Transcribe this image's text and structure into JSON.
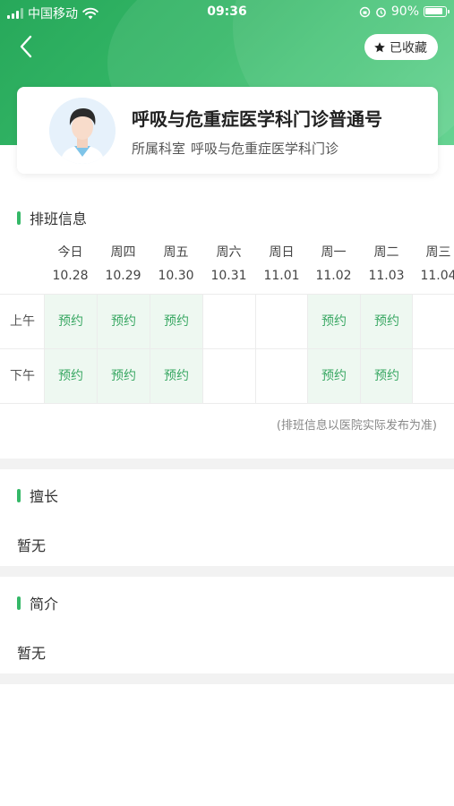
{
  "status_bar": {
    "carrier": "中国移动",
    "time": "09:36",
    "battery": "90%"
  },
  "header": {
    "favorite_label": "已收藏"
  },
  "doctor": {
    "name": "呼吸与危重症医学科门诊普通号",
    "dept_label": "所属科室",
    "dept_value": "呼吸与危重症医学科门诊"
  },
  "schedule": {
    "title": "排班信息",
    "days": [
      {
        "week": "今日",
        "date": "10.28"
      },
      {
        "week": "周四",
        "date": "10.29"
      },
      {
        "week": "周五",
        "date": "10.30"
      },
      {
        "week": "周六",
        "date": "10.31"
      },
      {
        "week": "周日",
        "date": "11.01"
      },
      {
        "week": "周一",
        "date": "11.02"
      },
      {
        "week": "周二",
        "date": "11.03"
      },
      {
        "week": "周三",
        "date": "11.04"
      }
    ],
    "rows": [
      {
        "label": "上午",
        "cells": [
          "预约",
          "预约",
          "预约",
          "",
          "",
          "预约",
          "预约",
          ""
        ]
      },
      {
        "label": "下午",
        "cells": [
          "预约",
          "预约",
          "预约",
          "",
          "",
          "预约",
          "预约",
          ""
        ]
      }
    ],
    "note": "(排班信息以医院实际发布为准)"
  },
  "specialty": {
    "title": "擅长",
    "content": "暂无"
  },
  "intro": {
    "title": "简介",
    "content": "暂无"
  },
  "colors": {
    "brand": "#35b868",
    "available_bg": "#eef8f1",
    "available_text": "#3aa864"
  },
  "icons": [
    "back-arrow-icon",
    "star-icon",
    "wifi-icon",
    "signal-icon",
    "battery-icon",
    "alarm-icon",
    "rotation-lock-icon"
  ]
}
